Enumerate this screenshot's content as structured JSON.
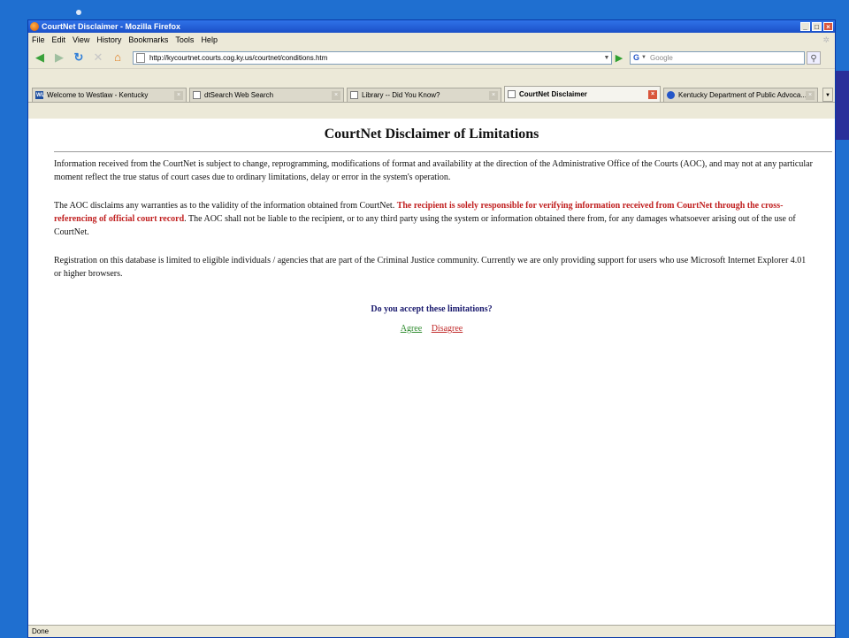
{
  "window": {
    "title": "CourtNet Disclaimer - Mozilla Firefox"
  },
  "window_buttons": {
    "minimize": "_",
    "maximize": "□",
    "close": "×"
  },
  "menu": [
    {
      "label": "File"
    },
    {
      "label": "Edit"
    },
    {
      "label": "View"
    },
    {
      "label": "History"
    },
    {
      "label": "Bookmarks"
    },
    {
      "label": "Tools"
    },
    {
      "label": "Help"
    }
  ],
  "nav": {
    "url": "http://kycourtnet.courts.cog.ky.us/courtnet/conditions.htm",
    "search_placeholder": "Google",
    "search_engine_glyph": "G"
  },
  "tabs": [
    {
      "label": "Welcome to Westlaw - Kentucky",
      "icon": "westlaw-icon",
      "icon_text": "WL",
      "active": false
    },
    {
      "label": "dtSearch Web Search",
      "icon": "page-icon",
      "active": false
    },
    {
      "label": "Library -- Did You Know?",
      "icon": "page-icon",
      "active": false
    },
    {
      "label": "CourtNet Disclaimer",
      "icon": "page-icon",
      "active": true
    },
    {
      "label": "Kentucky Department of Public Advoca...",
      "icon": "globe-icon",
      "active": false
    }
  ],
  "page": {
    "title": "CourtNet Disclaimer of Limitations",
    "p1": "Information received from the CourtNet is subject to change, reprogramming, modifications of format and availability at the direction of the Administrative Office of the Courts (AOC), and may not at any particular moment reflect the true status of court cases due to ordinary limitations, delay or error in the system's operation.",
    "p2_a": "The AOC disclaims any warranties as to the validity of the information obtained from CourtNet. ",
    "p2_red": "The recipient is solely responsible for verifying information received from CourtNet through the cross-referencing of official court record",
    "p2_b": ". The AOC shall not be liable to the recipient, or to any third party using the system or information obtained there from, for any damages whatsoever arising out of the use of CourtNet.",
    "p3": "Registration on this database is limited to eligible individuals / agencies that are part of the Criminal Justice community. Currently we are only providing support for users who use Microsoft Internet Explorer 4.01 or higher browsers.",
    "question": "Do you accept these limitations?",
    "agree": "Agree",
    "disagree": "Disagree"
  },
  "status": "Done",
  "colors": {
    "title_red": "#c01f1f",
    "agree_green": "#2e8b2e",
    "slide_blue": "#1f6fd0"
  }
}
